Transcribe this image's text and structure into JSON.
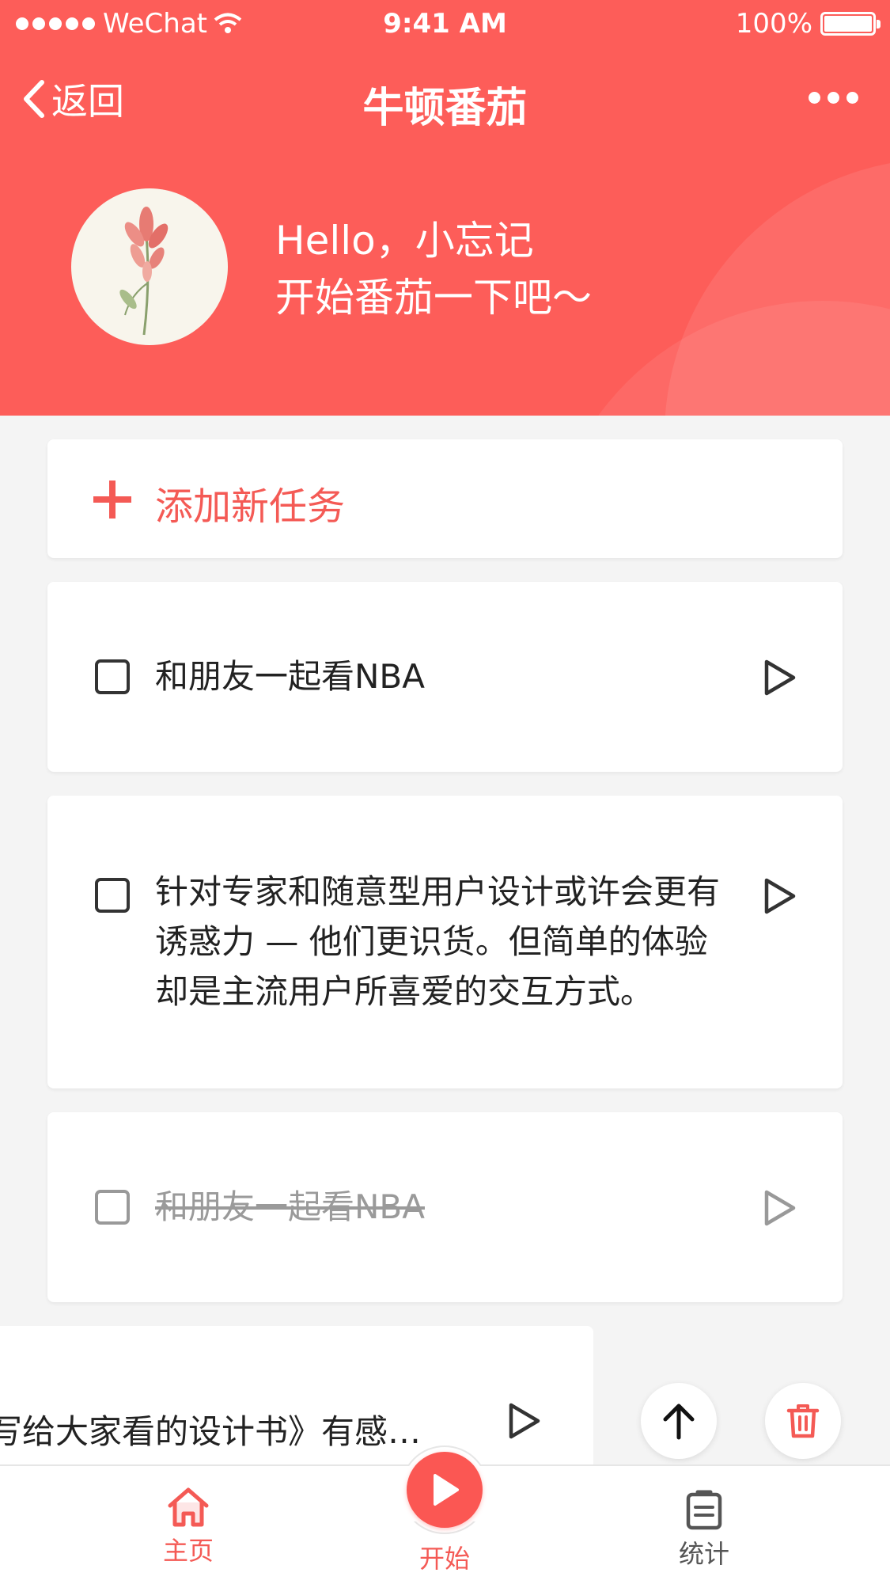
{
  "status_bar": {
    "carrier": "WeChat",
    "time": "9:41 AM",
    "battery": "100%"
  },
  "nav": {
    "back_label": "返回",
    "title": "牛顿番茄"
  },
  "greeting": {
    "line1": "Hello，小忘记",
    "line2": "开始番茄一下吧～"
  },
  "add_task": {
    "label": "添加新任务"
  },
  "tasks": [
    {
      "text": "和朋友一起看NBA",
      "done": false
    },
    {
      "text": "针对专家和随意型用户设计或许会更有诱惑力 — 他们更识货。但简单的体验却是主流用户所喜爱的交互方式。",
      "done": false
    },
    {
      "text": "和朋友一起看NBA",
      "done": true
    }
  ],
  "swiped_task": {
    "text": "写给大家看的设计书》有感…"
  },
  "colors": {
    "accent": "#fd5d59",
    "background": "#f4f4f4"
  },
  "icons": [
    "chevron-left-icon",
    "more-icon",
    "plus-icon",
    "checkbox-icon",
    "play-icon",
    "arrow-up-icon",
    "trash-icon",
    "home-icon",
    "clipboard-icon"
  ],
  "tabbar": {
    "home": "主页",
    "start": "开始",
    "stats": "统计"
  }
}
